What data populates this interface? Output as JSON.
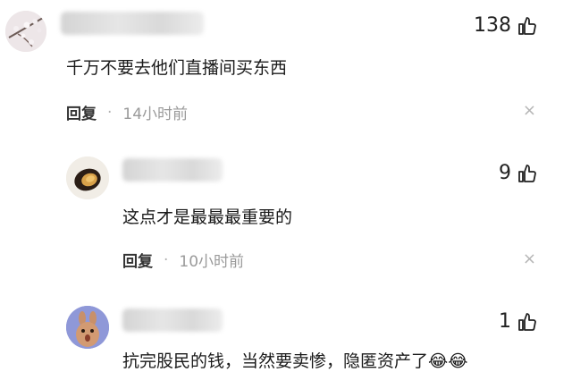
{
  "comments": [
    {
      "likes": "138",
      "text": "千万不要去他们直播间买东西",
      "reply_label": "回复",
      "time": "14小时前",
      "close": "×"
    },
    {
      "likes": "9",
      "text": "这点才是最最最重要的",
      "reply_label": "回复",
      "time": "10小时前",
      "close": "×"
    },
    {
      "likes": "1",
      "text": "抗完股民的钱，当然要卖惨，隐匿资产了",
      "emoji": "😂😂"
    }
  ],
  "separator": "·"
}
